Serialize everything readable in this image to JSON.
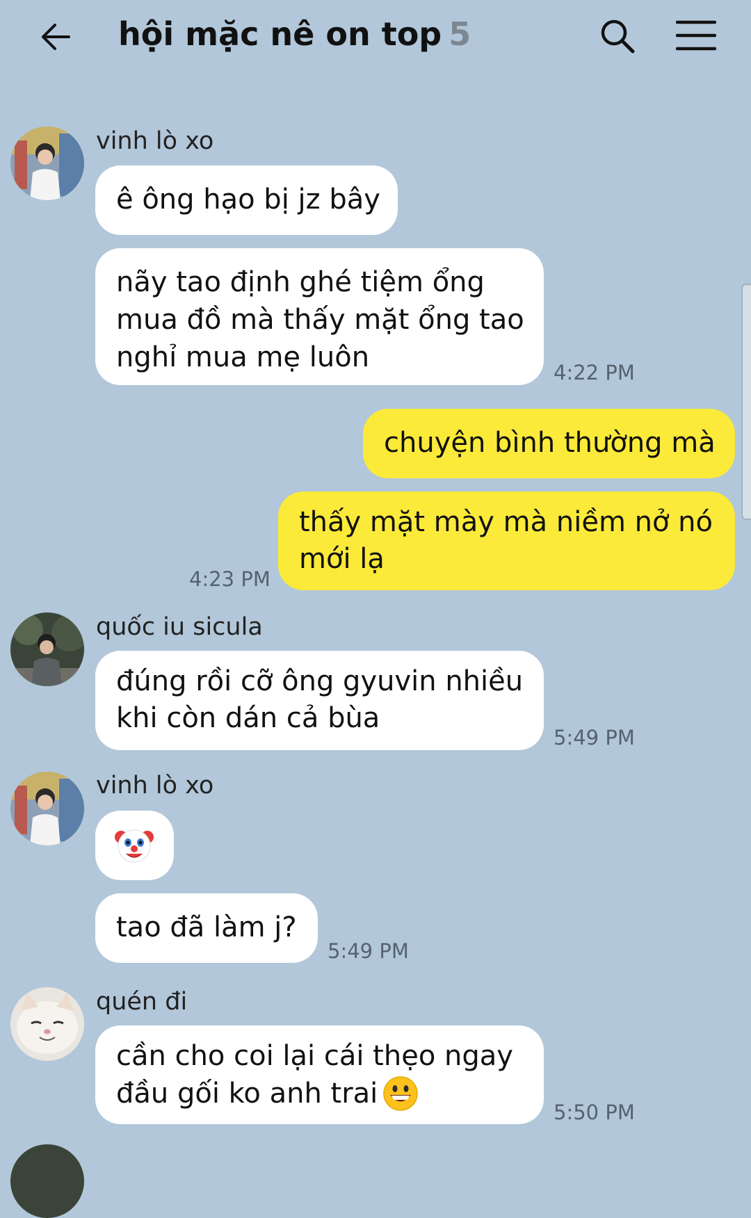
{
  "header": {
    "title": "hội mặc nê on top",
    "member_count": "5",
    "icons": {
      "back": "back-arrow-icon",
      "search": "search-icon",
      "menu": "menu-icon"
    }
  },
  "colors": {
    "background": "#b2c7d9",
    "incoming_bubble": "#ffffff",
    "outgoing_bubble": "#fbea39"
  },
  "messages": [
    {
      "sender": "vinh lò xo",
      "text": "ê ông hạo bị jz bây"
    },
    {
      "lines": [
        "nãy tao định ghé tiệm ổng",
        "mua đồ mà thấy mặt ổng tao",
        "nghỉ mua mẹ luôn"
      ],
      "time": "4:22 PM"
    },
    {
      "mine": true,
      "text": "chuyện bình thường mà"
    },
    {
      "mine": true,
      "lines": [
        "thấy mặt mày mà niềm nở nó",
        "mới lạ"
      ],
      "time": "4:23 PM"
    },
    {
      "sender": "quốc iu sicula",
      "lines": [
        "đúng rồi cỡ ông gyuvin nhiều",
        "khi còn dán cả bùa"
      ],
      "time": "5:49 PM"
    },
    {
      "sender": "vinh lò xo",
      "emoji": "clown-face-emoji"
    },
    {
      "text": "tao đã làm j?",
      "time": "5:49 PM"
    },
    {
      "sender": "quén đi",
      "lines": [
        "cần cho coi lại cái thẹo ngay",
        "đầu gối ko anh trai"
      ],
      "trailing_emoji": "grinning-face-emoji",
      "time": "5:50 PM"
    }
  ]
}
